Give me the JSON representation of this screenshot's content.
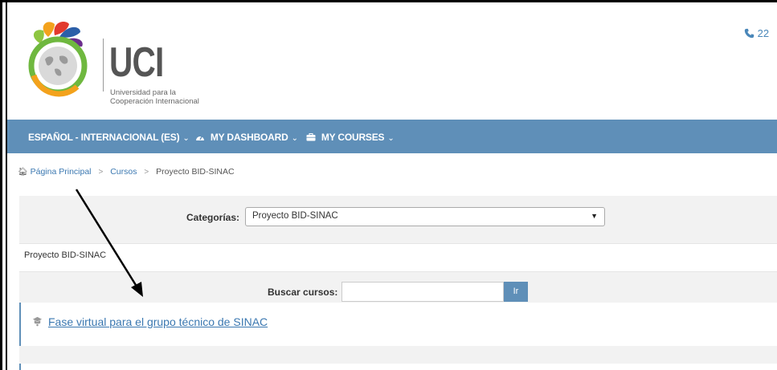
{
  "header": {
    "logo_title": "UCI",
    "logo_subtitle_line1": "Universidad para la",
    "logo_subtitle_line2": "Cooperación Internacional",
    "phone_icon": "phone-icon",
    "phone_text": "22"
  },
  "nav": {
    "items": [
      {
        "label": "ESPAÑOL - INTERNACIONAL (ES)",
        "icon": ""
      },
      {
        "label": "MY DASHBOARD",
        "icon": "dashboard-icon"
      },
      {
        "label": "MY COURSES",
        "icon": "briefcase-icon"
      }
    ],
    "caret": "⌄",
    "color": "#5f8fb8"
  },
  "breadcrumb": {
    "home": "Página Principal",
    "courses": "Cursos",
    "current": "Proyecto BID-SINAC"
  },
  "category": {
    "label": "Categorías:",
    "selected": "Proyecto BID-SINAC",
    "name": "Proyecto BID-SINAC"
  },
  "search": {
    "label": "Buscar cursos:",
    "value": "",
    "button": "Ir"
  },
  "course": {
    "title": "Fase virtual para el grupo técnico de SINAC"
  }
}
